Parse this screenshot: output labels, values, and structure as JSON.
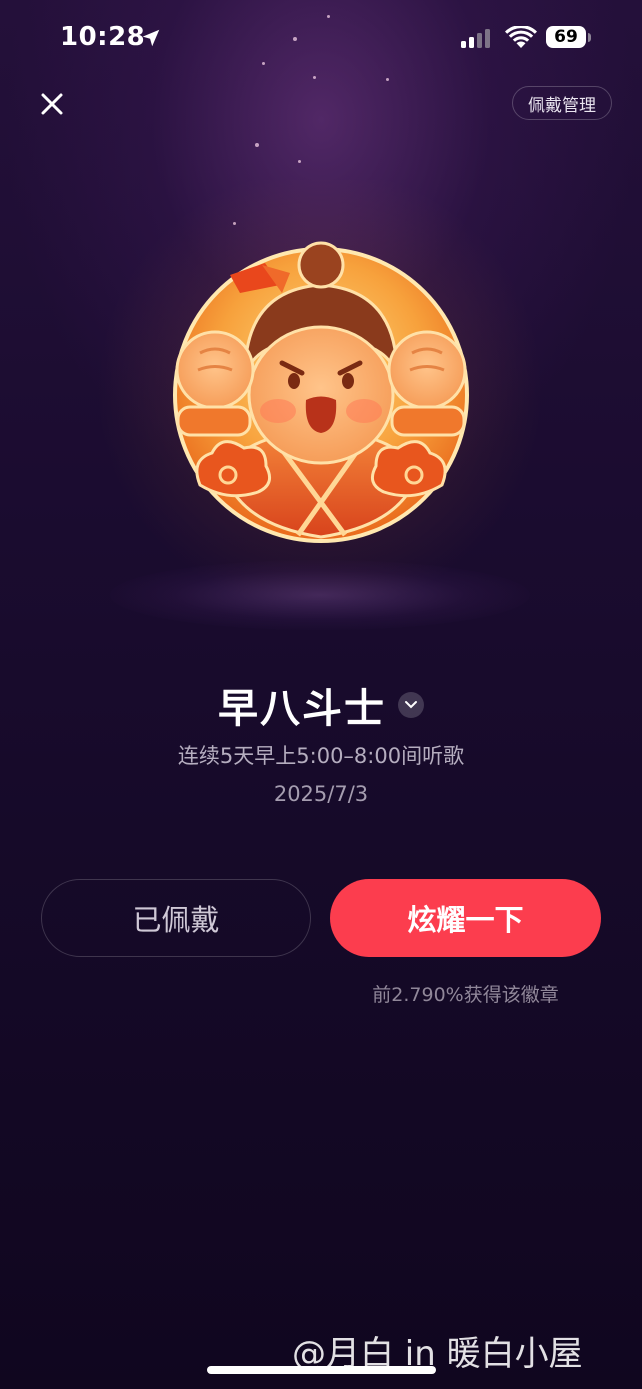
{
  "status_bar": {
    "time": "10:28",
    "battery": "69"
  },
  "header": {
    "manage_label": "佩戴管理"
  },
  "badge": {
    "title": "早八斗士",
    "description": "连续5天早上5:00–8:00间听歌",
    "date": "2025/7/3"
  },
  "actions": {
    "worn_label": "已佩戴",
    "show_label": "炫耀一下",
    "rank_text": "前2.790%获得该徽章"
  },
  "watermark": "@月白 in 暖白小屋",
  "colors": {
    "accent": "#fc3d4e",
    "background": "#1b0c30"
  }
}
